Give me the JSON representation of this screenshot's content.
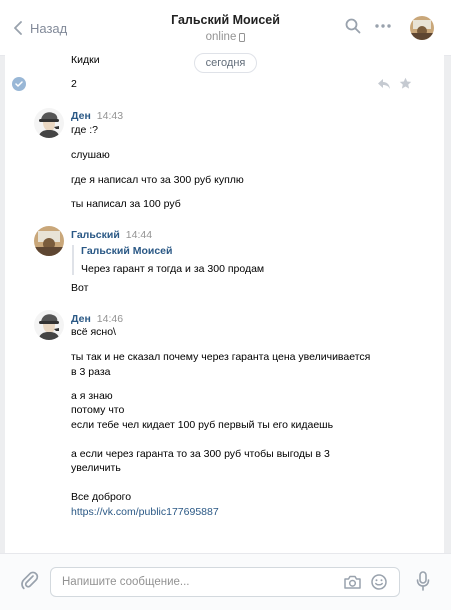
{
  "header": {
    "back_label": "Назад",
    "title": "Гальский Моисей",
    "status": "online"
  },
  "date_divider": "сегодня",
  "messages": [
    {
      "text": "Кидки"
    },
    {
      "text": "2"
    }
  ],
  "groups": [
    {
      "author": "Ден",
      "time": "14:43",
      "lines": [
        "где :?",
        "слушаю",
        "где я написал что за 300 руб куплю",
        "ты написал за 100 руб"
      ]
    },
    {
      "author": "Гальский",
      "time": "14:44",
      "quote_author": "Гальский Моисей",
      "quote_text": "Через гарант я тогда и за 300 продам",
      "lines": [
        "Вот"
      ]
    },
    {
      "author": "Ден",
      "time": "14:46",
      "lines": [
        "всё ясно\\",
        "ты так и не сказал почему через гаранта цена увеличивается",
        "в 3 раза",
        "а я знаю",
        "потому что",
        "если тебе чел кидает 100 руб первый ты его кидаешь",
        "а если через гаранта то за 300 руб чтобы выгоды в 3",
        "увеличить",
        "Все доброго",
        "https://vk.com/public177695887"
      ]
    }
  ],
  "composer": {
    "placeholder": "Напишите сообщение..."
  },
  "icons": {
    "back": "chevron-left-icon",
    "search": "search-icon",
    "more": "more-icon",
    "reply": "reply-icon",
    "star": "star-icon",
    "attach": "paperclip-icon",
    "camera": "camera-icon",
    "emoji": "smile-icon",
    "mic": "microphone-icon",
    "phone": "phone-icon"
  },
  "colors": {
    "link": "#2a5885",
    "accent": "#99b7d6",
    "meta": "#939393",
    "background": "#edeef0"
  }
}
